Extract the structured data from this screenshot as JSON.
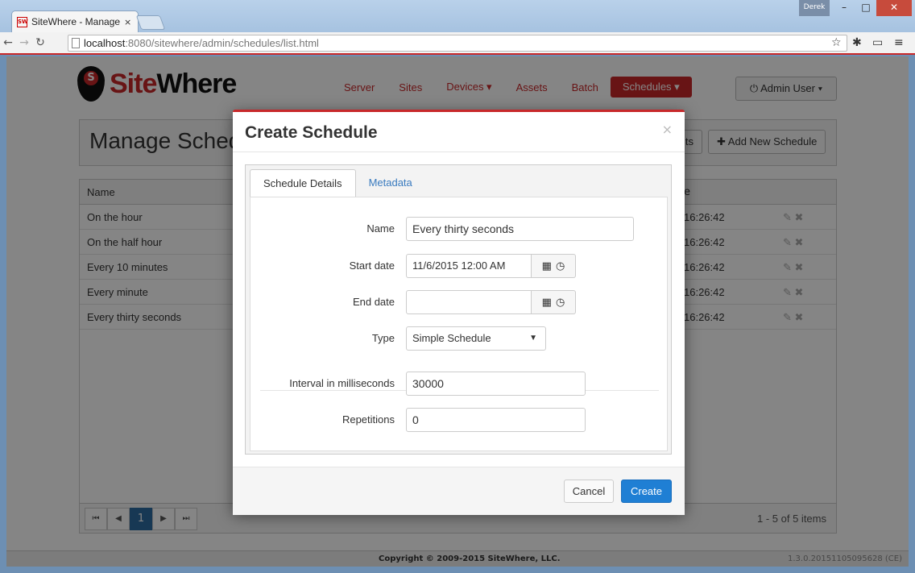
{
  "browser": {
    "tab_title": "SiteWhere - Manage",
    "tab_close": "×",
    "favicon": "SW",
    "user_badge": "Derek",
    "min": "–",
    "max": "□",
    "close": "✕",
    "url_host": "localhost",
    "url_path": ":8080/sitewhere/admin/schedules/list.html"
  },
  "app": {
    "logo_site": "Site",
    "logo_where": "Where",
    "nav": [
      "Server",
      "Sites",
      "Devices ▾",
      "Assets",
      "Batch",
      "Schedules ▾"
    ],
    "user_menu": "⏻ Admin User ▾",
    "page_title": "Manage Schedules",
    "btn_refresh": "lts",
    "btn_add": "✚ Add New Schedule",
    "grid_col_name": "Name",
    "grid_col_date": "e",
    "rows": [
      {
        "name": "On the hour",
        "date": "16:26:42"
      },
      {
        "name": "On the half hour",
        "date": "16:26:42"
      },
      {
        "name": "Every 10 minutes",
        "date": "16:26:42"
      },
      {
        "name": "Every minute",
        "date": "16:26:42"
      },
      {
        "name": "Every thirty seconds",
        "date": "16:26:42"
      }
    ],
    "pager_page": "1",
    "pager_info": "1 - 5 of 5 items",
    "copyright": "Copyright © 2009-2015 SiteWhere, LLC.",
    "version": "1.3.0.20151105095628 (CE)"
  },
  "modal": {
    "title": "Create Schedule",
    "close": "×",
    "tab_details": "Schedule Details",
    "tab_metadata": "Metadata",
    "label_name": "Name",
    "value_name": "Every thirty seconds",
    "label_start": "Start date",
    "value_start": "11/6/2015 12:00 AM",
    "label_end": "End date",
    "value_end": "",
    "label_type": "Type",
    "value_type": "Simple Schedule",
    "label_interval": "Interval in milliseconds",
    "value_interval": "30000",
    "label_repetitions": "Repetitions",
    "value_repetitions": "0",
    "btn_cancel": "Cancel",
    "btn_create": "Create"
  }
}
